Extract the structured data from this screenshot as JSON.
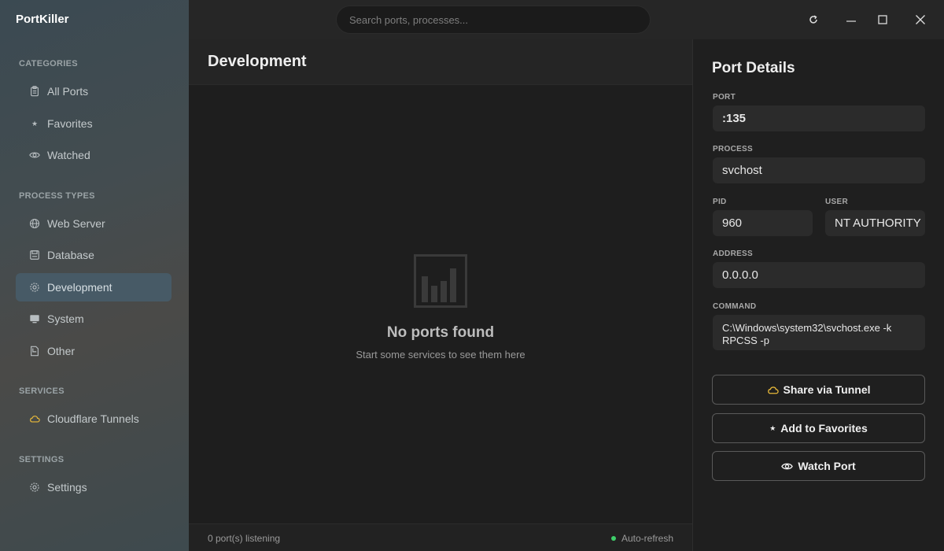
{
  "app": {
    "title": "PortKiller"
  },
  "search": {
    "placeholder": "Search ports, processes..."
  },
  "sidebar": {
    "categories_label": "CATEGORIES",
    "categories": [
      {
        "label": "All Ports",
        "icon": "clipboard-icon"
      },
      {
        "label": "Favorites",
        "icon": "star-icon"
      },
      {
        "label": "Watched",
        "icon": "eye-icon"
      }
    ],
    "process_types_label": "PROCESS TYPES",
    "process_types": [
      {
        "label": "Web Server",
        "icon": "globe-icon"
      },
      {
        "label": "Database",
        "icon": "database-icon"
      },
      {
        "label": "Development",
        "icon": "gear-icon",
        "active": true
      },
      {
        "label": "System",
        "icon": "monitor-icon"
      },
      {
        "label": "Other",
        "icon": "file-icon"
      }
    ],
    "services_label": "SERVICES",
    "services": [
      {
        "label": "Cloudflare Tunnels",
        "icon": "cloud-icon"
      }
    ],
    "settings_label": "SETTINGS",
    "settings": [
      {
        "label": "Settings",
        "icon": "gear-icon"
      }
    ]
  },
  "main": {
    "title": "Development",
    "empty_title": "No ports found",
    "empty_subtitle": "Start some services to see them here"
  },
  "footer": {
    "count": "0 port(s) listening",
    "auto_refresh": "Auto-refresh"
  },
  "details": {
    "title": "Port Details",
    "port_label": "PORT",
    "port": ":135",
    "process_label": "PROCESS",
    "process": "svchost",
    "pid_label": "PID",
    "pid": "960",
    "user_label": "USER",
    "user": "NT AUTHORITY",
    "address_label": "ADDRESS",
    "address": "0.0.0.0",
    "command_label": "COMMAND",
    "command": "C:\\Windows\\system32\\svchost.exe -k RPCSS -p",
    "share_label": "Share via Tunnel",
    "favorite_label": "Add to Favorites",
    "watch_label": "Watch Port"
  },
  "colors": {
    "accent_active": "#475a66",
    "status_green": "#3ecf6a",
    "cloud_yellow": "#e8b93a"
  }
}
